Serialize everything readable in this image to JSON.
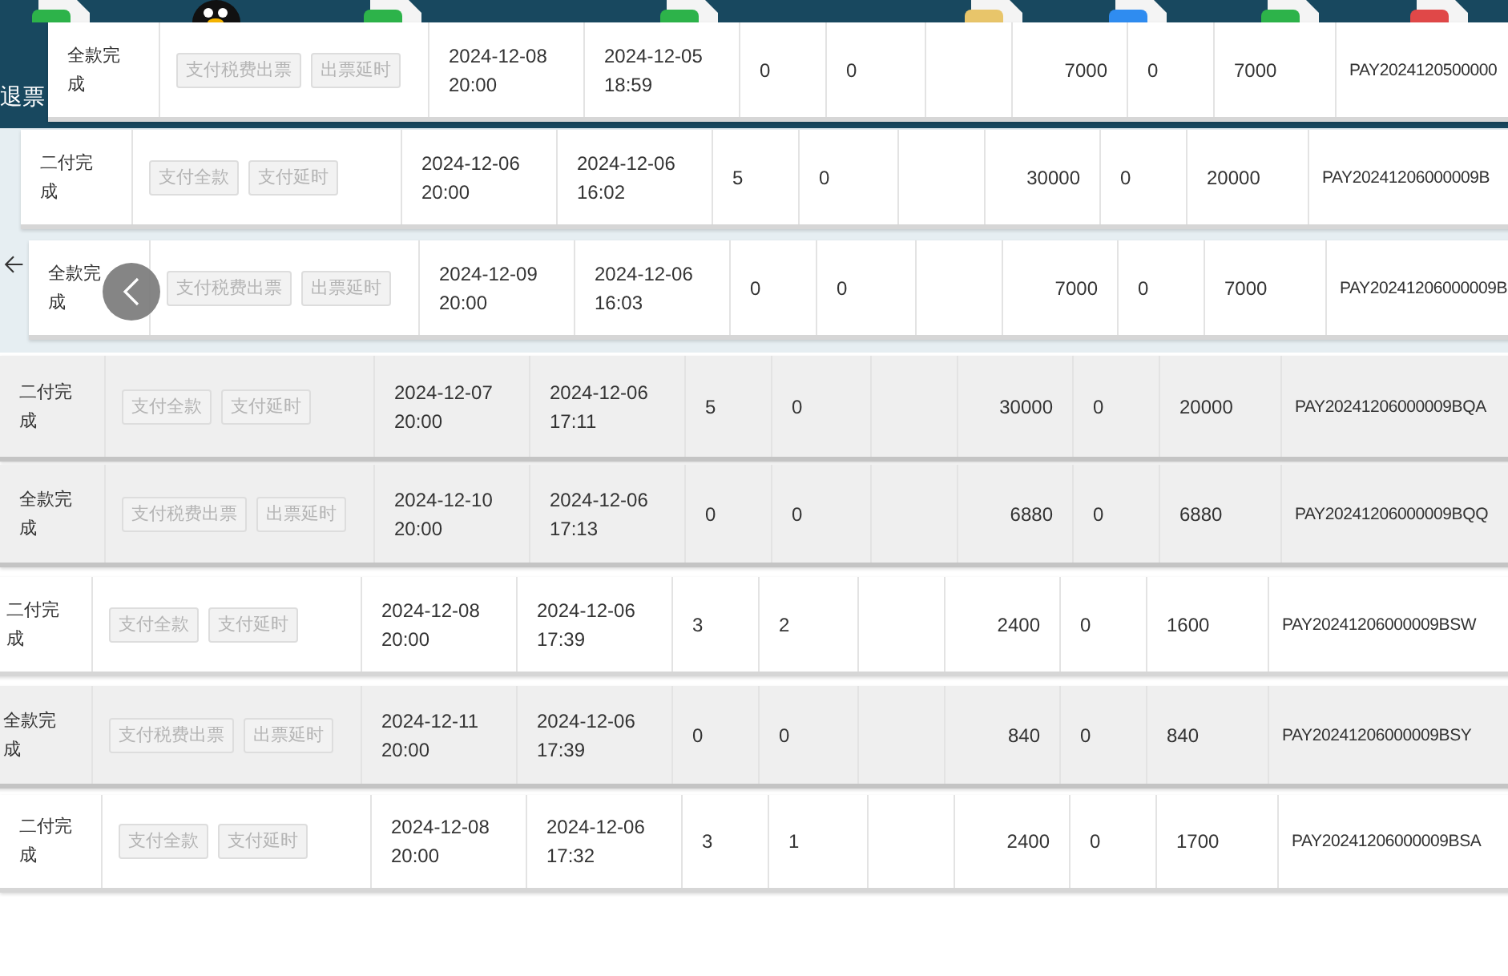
{
  "desktop": {
    "label": "退票"
  },
  "rows": [
    {
      "status": "全款完成",
      "highlighted": false,
      "actions": [
        {
          "label": "支付税费出票",
          "disabled": true
        },
        {
          "label": "出票延时",
          "disabled": true
        }
      ],
      "deadline": "2024-12-08 20:00",
      "created": "2024-12-05 18:59",
      "column_5": "0",
      "column_6": "0",
      "column_8": "7000",
      "column_9": "0",
      "column_10": "7000",
      "payment_id": "PAY2024120500000"
    },
    {
      "status": "二付完成",
      "highlighted": false,
      "actions": [
        {
          "label": "支付全款",
          "disabled": true
        },
        {
          "label": "支付延时",
          "disabled": true
        }
      ],
      "deadline": "2024-12-06 20:00",
      "created": "2024-12-06 16:02",
      "column_5": "5",
      "column_6": "0",
      "column_8": "30000",
      "column_9": "0",
      "column_10": "20000",
      "payment_id": "PAY20241206000009B"
    },
    {
      "status": "全款完成",
      "highlighted": false,
      "actions": [
        {
          "label": "支付税费出票",
          "disabled": true
        },
        {
          "label": "出票延时",
          "disabled": true
        }
      ],
      "deadline": "2024-12-09 20:00",
      "created": "2024-12-06 16:03",
      "column_5": "0",
      "column_6": "0",
      "column_8": "7000",
      "column_9": "0",
      "column_10": "7000",
      "payment_id": "PAY20241206000009B"
    },
    {
      "status": "二付完成",
      "highlighted": true,
      "actions": [
        {
          "label": "支付全款",
          "disabled": true
        },
        {
          "label": "支付延时",
          "disabled": true
        }
      ],
      "deadline": "2024-12-07 20:00",
      "created": "2024-12-06 17:11",
      "column_5": "5",
      "column_6": "0",
      "column_8": "30000",
      "column_9": "0",
      "column_10": "20000",
      "payment_id": "PAY20241206000009BQA"
    },
    {
      "status": "全款完成",
      "highlighted": true,
      "actions": [
        {
          "label": "支付税费出票",
          "disabled": true
        },
        {
          "label": "出票延时",
          "disabled": true
        }
      ],
      "deadline": "2024-12-10 20:00",
      "created": "2024-12-06 17:13",
      "column_5": "0",
      "column_6": "0",
      "column_8": "6880",
      "column_9": "0",
      "column_10": "6880",
      "payment_id": "PAY20241206000009BQQ"
    },
    {
      "status": "二付完成",
      "highlighted": false,
      "actions": [
        {
          "label": "支付全款",
          "disabled": true
        },
        {
          "label": "支付延时",
          "disabled": true
        }
      ],
      "deadline": "2024-12-08 20:00",
      "created": "2024-12-06 17:39",
      "column_5": "3",
      "column_6": "2",
      "column_8": "2400",
      "column_9": "0",
      "column_10": "1600",
      "payment_id": "PAY20241206000009BSW"
    },
    {
      "status": "全款完成",
      "highlighted": true,
      "actions": [
        {
          "label": "支付税费出票",
          "disabled": true
        },
        {
          "label": "出票延时",
          "disabled": true
        }
      ],
      "deadline": "2024-12-11 20:00",
      "created": "2024-12-06 17:39",
      "column_5": "0",
      "column_6": "0",
      "column_8": "840",
      "column_9": "0",
      "column_10": "840",
      "payment_id": "PAY20241206000009BSY"
    },
    {
      "status": "二付完成",
      "highlighted": false,
      "actions": [
        {
          "label": "支付全款",
          "disabled": true
        },
        {
          "label": "支付延时",
          "disabled": true
        }
      ],
      "deadline": "2024-12-08 20:00",
      "created": "2024-12-06 17:32",
      "column_5": "3",
      "column_6": "1",
      "column_8": "2400",
      "column_9": "0",
      "column_10": "1700",
      "payment_id": "PAY20241206000009BSA"
    }
  ]
}
